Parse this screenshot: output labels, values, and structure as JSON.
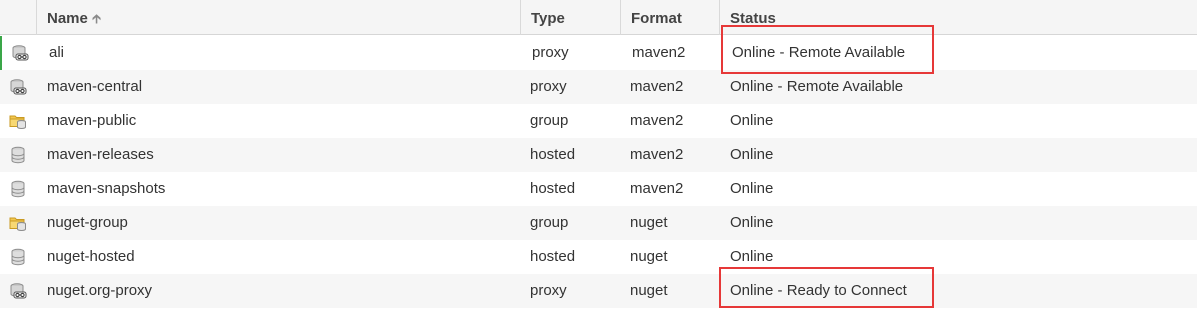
{
  "columns": {
    "name": "Name",
    "type": "Type",
    "format": "Format",
    "status": "Status"
  },
  "sort_icon": "arrow-up-icon",
  "colors": {
    "highlight": "#e63838",
    "selection": "#3aa648",
    "folder": "#e8b33a",
    "header_bg": "#f5f5f5"
  },
  "rows": [
    {
      "name": "ali",
      "type": "proxy",
      "format": "maven2",
      "status": "Online - Remote Available",
      "icon": "proxy-repository-icon"
    },
    {
      "name": "maven-central",
      "type": "proxy",
      "format": "maven2",
      "status": "Online - Remote Available",
      "icon": "proxy-repository-icon"
    },
    {
      "name": "maven-public",
      "type": "group",
      "format": "maven2",
      "status": "Online",
      "icon": "group-repository-icon"
    },
    {
      "name": "maven-releases",
      "type": "hosted",
      "format": "maven2",
      "status": "Online",
      "icon": "hosted-repository-icon"
    },
    {
      "name": "maven-snapshots",
      "type": "hosted",
      "format": "maven2",
      "status": "Online",
      "icon": "hosted-repository-icon"
    },
    {
      "name": "nuget-group",
      "type": "group",
      "format": "nuget",
      "status": "Online",
      "icon": "group-repository-icon"
    },
    {
      "name": "nuget-hosted",
      "type": "hosted",
      "format": "nuget",
      "status": "Online",
      "icon": "hosted-repository-icon"
    },
    {
      "name": "nuget.org-proxy",
      "type": "proxy",
      "format": "nuget",
      "status": "Online - Ready to Connect",
      "icon": "proxy-repository-icon"
    }
  ]
}
